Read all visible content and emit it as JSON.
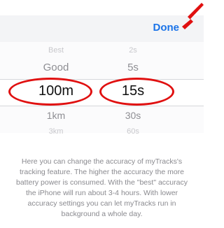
{
  "toolbar": {
    "done_label": "Done"
  },
  "picker": {
    "accuracy": {
      "options": [
        "Best",
        "Good",
        "100m",
        "1km",
        "3km"
      ],
      "selected": "100m"
    },
    "interval": {
      "options": [
        "2s",
        "5s",
        "15s",
        "30s",
        "60s"
      ],
      "selected": "15s"
    }
  },
  "help_text": "Here you can change the accuracy of myTracks's tracking feature. The higher the accuracy the more battery power is consumed. With the \"best\" accuracy the iPhone will run about 3-4 hours. With lower accuracy settings you can let myTracks run in background a whole day.",
  "colors": {
    "accent": "#1a73e8",
    "highlight": "#e01010"
  }
}
